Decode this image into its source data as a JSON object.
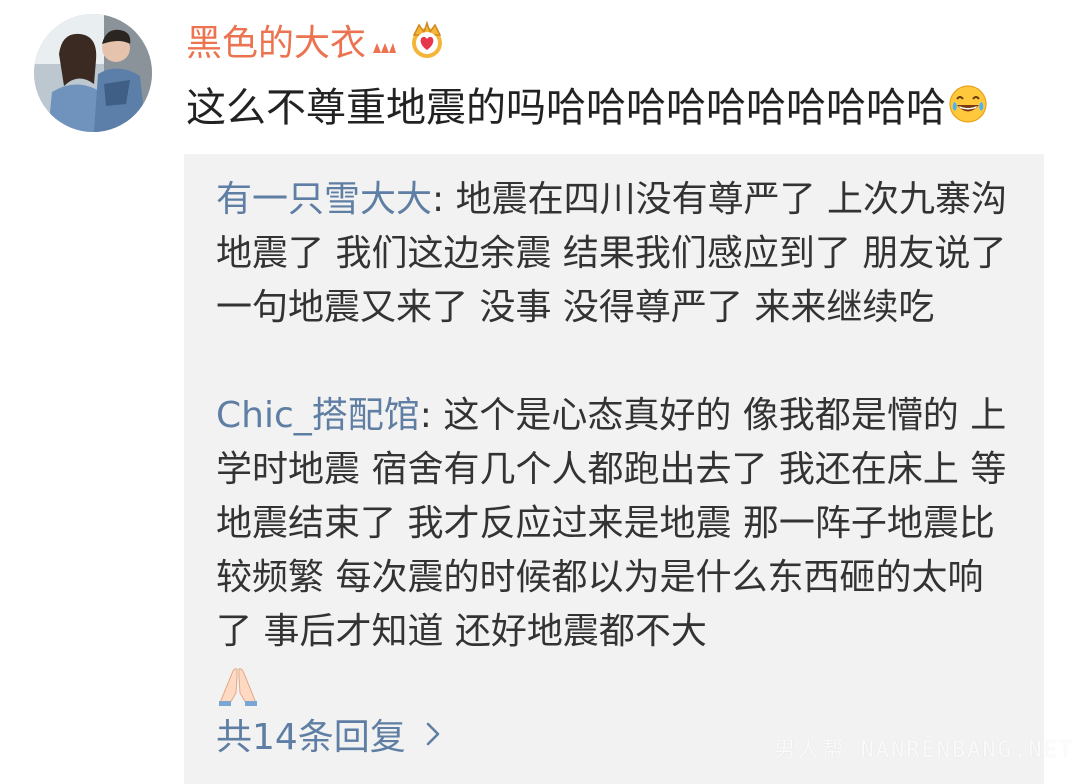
{
  "comment": {
    "username": "黑色的大衣",
    "text": "这么不尊重地震的吗哈哈哈哈哈哈哈哈哈哈",
    "username_color": "#eb7350",
    "icons": [
      "avatar",
      "level-icon",
      "crown-icon",
      "laugh-emoji-icon"
    ]
  },
  "replies": [
    {
      "author": "有一只雪大大",
      "separator": ": ",
      "text": "地震在四川没有尊严了  上次九寨沟地震了  我们这边余震  结果我们感应到了  朋友说了一句地震又来了  没事  没得尊严了  来来继续吃"
    },
    {
      "author": "Chic_搭配馆",
      "separator": ": ",
      "text": "这个是心态真好的 像我都是懵的 上学时地震 宿舍有几个人都跑出去了 我还在床上 等地震结束了 我才反应过来是地震 那一阵子地震比较频繁 每次震的时候都以为是什么东西砸的太响了 事后才知道 还好地震都不大",
      "trailing_icon": "pray-emoji-icon"
    }
  ],
  "more_replies": {
    "label": "共14条回复",
    "icon": "chevron-right-icon"
  },
  "colors": {
    "author_link": "#5f7ea3",
    "reply_background": "#f2f2f2",
    "body_text": "#333333"
  },
  "watermark": "男人帮 NANRENBANG.NET"
}
